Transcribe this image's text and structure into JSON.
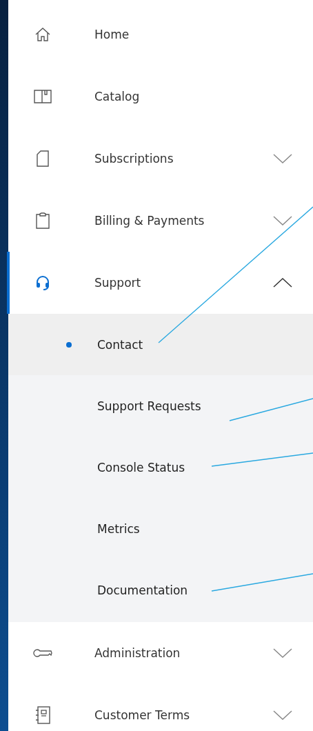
{
  "nav": [
    {
      "label": "Home",
      "kind": "link",
      "selected": false
    },
    {
      "label": "Catalog",
      "kind": "link",
      "selected": false
    },
    {
      "label": "Subscriptions",
      "kind": "group",
      "selected": false,
      "expanded": false
    },
    {
      "label": "Billing & Payments",
      "kind": "group",
      "selected": false,
      "expanded": false
    },
    {
      "label": "Support",
      "kind": "group",
      "selected": true,
      "expanded": true,
      "children": [
        {
          "label": "Contact",
          "selected": true
        },
        {
          "label": "Support Requests",
          "selected": false
        },
        {
          "label": "Console Status",
          "selected": false
        },
        {
          "label": "Metrics",
          "selected": false
        },
        {
          "label": "Documentation",
          "selected": false
        }
      ]
    },
    {
      "label": "Administration",
      "kind": "group",
      "selected": false,
      "expanded": false
    },
    {
      "label": "Customer Terms",
      "kind": "group",
      "selected": false,
      "expanded": false
    }
  ]
}
